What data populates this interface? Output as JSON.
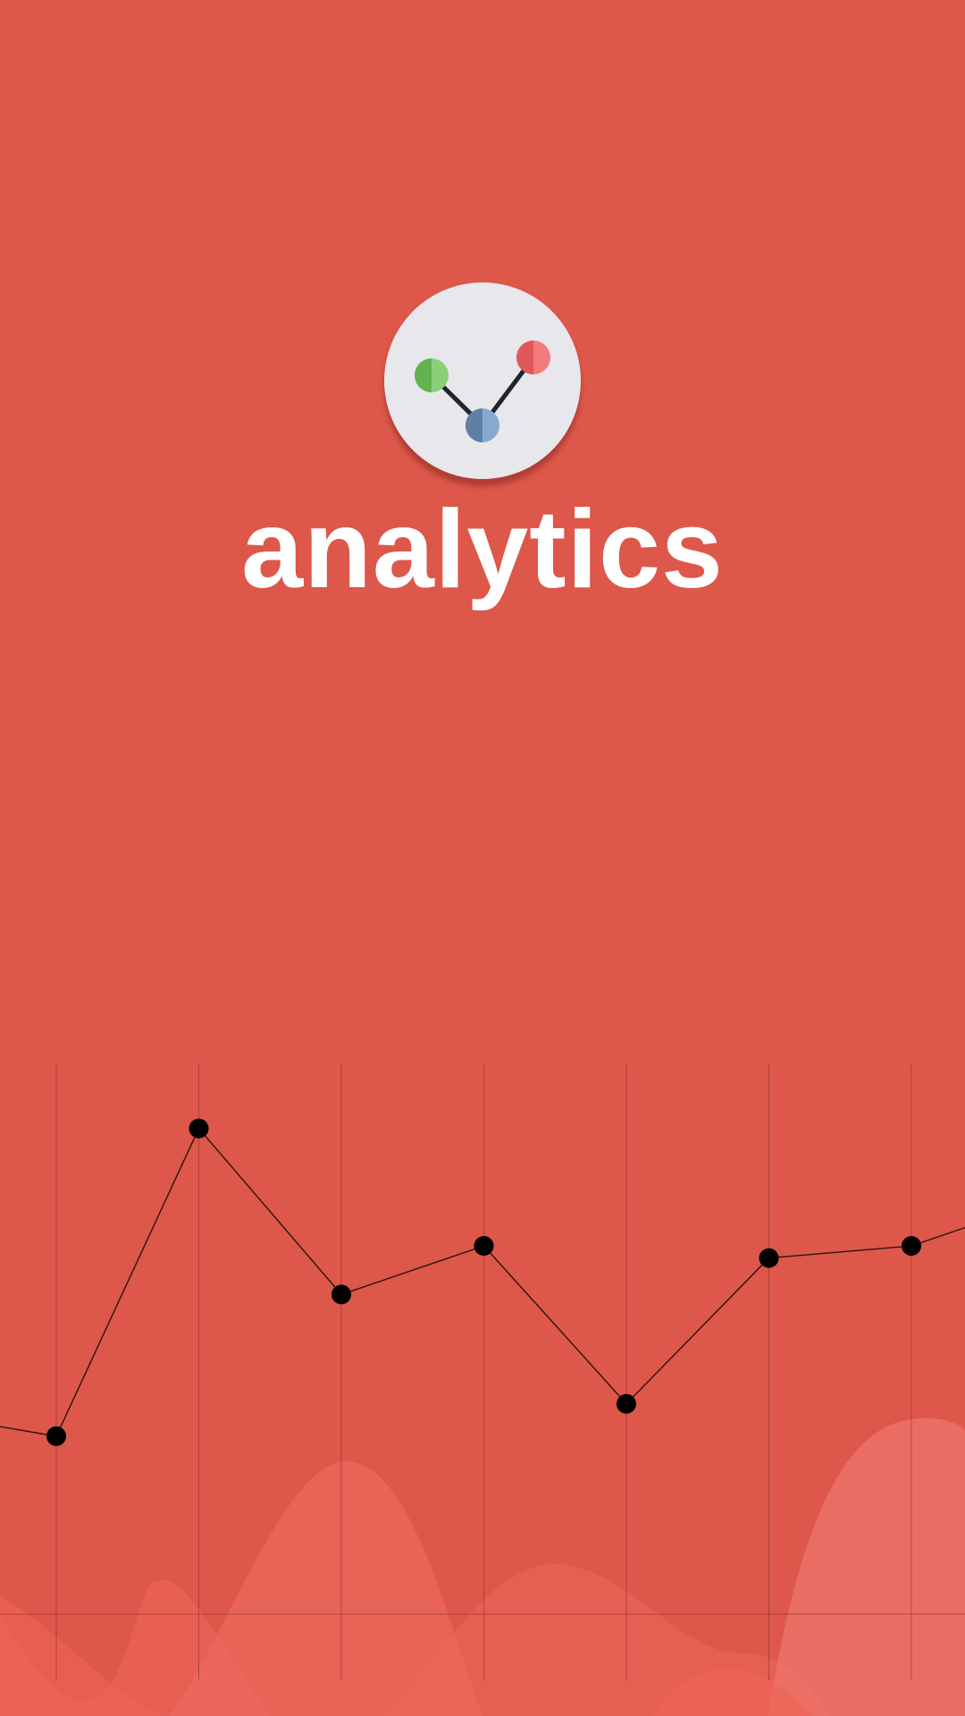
{
  "splash": {
    "app_name": "analytics",
    "background_color": "#dd574a",
    "logo": {
      "icon": "connected-nodes-icon",
      "circle_color": "#e7e7ec",
      "node_colors": [
        "#6cbb5c",
        "#ec5f61",
        "#6f8fb5"
      ]
    }
  },
  "chart_data": {
    "type": "line",
    "title": "",
    "xlabel": "",
    "ylabel": "",
    "grid": true,
    "decorative": true,
    "x": [
      -1,
      0,
      1,
      2,
      3,
      4,
      5,
      6,
      7
    ],
    "y": [
      25,
      19,
      95,
      54,
      66,
      27,
      63,
      66,
      78
    ]
  }
}
